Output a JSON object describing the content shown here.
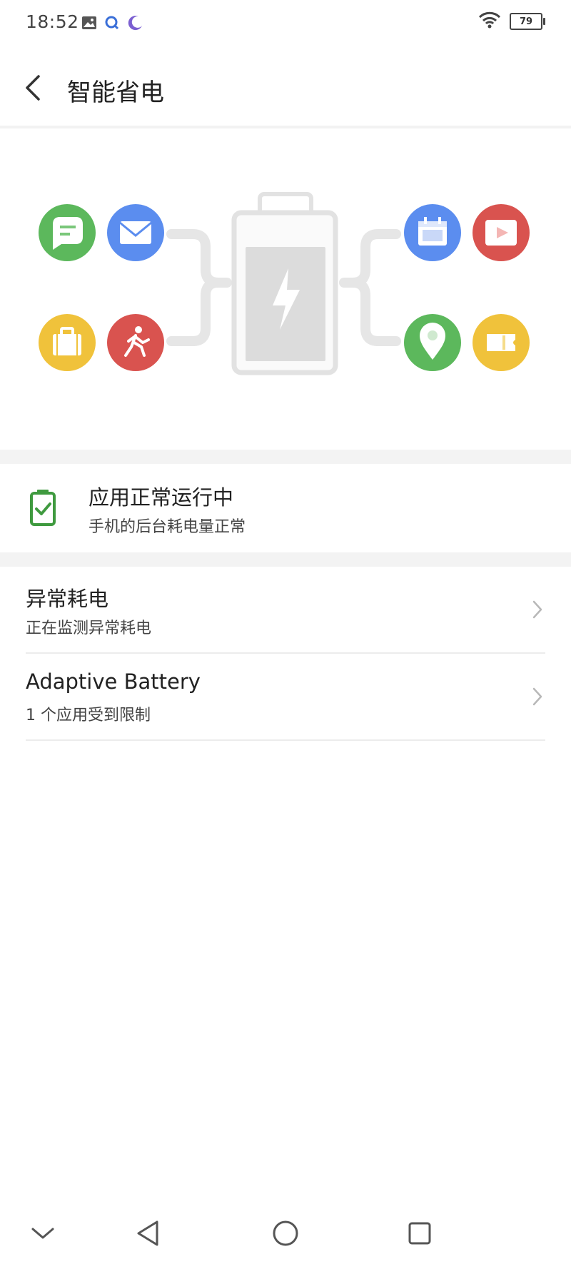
{
  "status_bar": {
    "time": "18:52",
    "battery_level": "79",
    "icons": [
      "image-icon",
      "search-app-icon",
      "moon-icon",
      "wifi-icon",
      "battery-icon"
    ]
  },
  "header": {
    "title": "智能省电",
    "back_icon": "chevron-left-icon"
  },
  "illustration": {
    "left_apps": [
      {
        "icon": "message-icon",
        "color": "#5cb85c"
      },
      {
        "icon": "mail-icon",
        "color": "#5b8def"
      },
      {
        "icon": "briefcase-icon",
        "color": "#f0c23b"
      },
      {
        "icon": "running-icon",
        "color": "#d9534f"
      }
    ],
    "right_apps": [
      {
        "icon": "calendar-icon",
        "color": "#5b8def"
      },
      {
        "icon": "video-icon",
        "color": "#d9534f"
      },
      {
        "icon": "location-icon",
        "color": "#5cb85c"
      },
      {
        "icon": "ticket-icon",
        "color": "#f0c23b"
      }
    ]
  },
  "status_card": {
    "title": "应用正常运行中",
    "subtitle": "手机的后台耗电量正常",
    "icon": "battery-check-icon",
    "icon_color": "#3f9a3f"
  },
  "list": {
    "items": [
      {
        "title": "异常耗电",
        "subtitle": "正在监测异常耗电"
      },
      {
        "title": "Adaptive Battery",
        "subtitle": "1 个应用受到限制"
      }
    ]
  },
  "nav_bar": {
    "buttons": [
      "collapse-icon",
      "back-triangle-icon",
      "home-circle-icon",
      "recents-square-icon"
    ]
  }
}
